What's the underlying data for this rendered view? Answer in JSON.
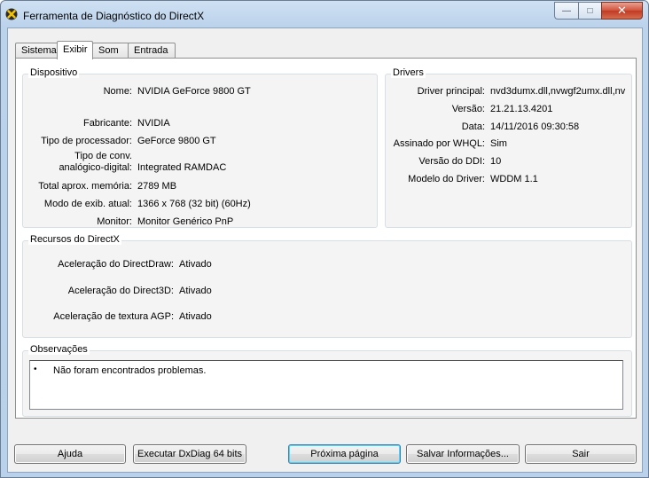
{
  "window": {
    "title": "Ferramenta de Diagnóstico do DirectX"
  },
  "caption": {
    "minimize": "—",
    "maximize": "□",
    "close": "✕"
  },
  "tabs": [
    "Sistema",
    "Exibir",
    "Som",
    "Entrada"
  ],
  "device": {
    "title": "Dispositivo",
    "rows": [
      {
        "label": "Nome:",
        "value": "NVIDIA GeForce 9800 GT"
      },
      {
        "label": "Fabricante:",
        "value": "NVIDIA"
      },
      {
        "label": "Tipo de processador:",
        "value": "GeForce 9800 GT"
      },
      {
        "label": "Tipo de conv.",
        "label2": "analógico-digital:",
        "value": "Integrated RAMDAC"
      },
      {
        "label": "Total aprox. memória:",
        "value": "2789 MB"
      },
      {
        "label": "Modo de exib. atual:",
        "value": "1366 x 768 (32 bit) (60Hz)"
      },
      {
        "label": "Monitor:",
        "value": "Monitor Genérico PnP"
      }
    ]
  },
  "drivers": {
    "title": "Drivers",
    "rows": [
      {
        "label": "Driver principal:",
        "value": "nvd3dumx.dll,nvwgf2umx.dll,nv"
      },
      {
        "label": "Versão:",
        "value": "21.21.13.4201"
      },
      {
        "label": "Data:",
        "value": "14/11/2016 09:30:58"
      },
      {
        "label": "Assinado por WHQL:",
        "value": "Sim"
      },
      {
        "label": "Versão do DDI:",
        "value": "10"
      },
      {
        "label": "Modelo do Driver:",
        "value": "WDDM 1.1"
      }
    ]
  },
  "directx": {
    "title": "Recursos do DirectX",
    "rows": [
      {
        "label": "Aceleração do DirectDraw:",
        "value": "Ativado"
      },
      {
        "label": "Aceleração do Direct3D:",
        "value": "Ativado"
      },
      {
        "label": "Aceleração de textura AGP:",
        "value": "Ativado"
      }
    ]
  },
  "notes": {
    "title": "Observações",
    "bullet": "•",
    "items": [
      "Não foram encontrados problemas."
    ]
  },
  "buttons": {
    "help": "Ajuda",
    "run64": "Executar DxDiag 64 bits",
    "next": "Próxima página",
    "save": "Salvar Informações...",
    "exit": "Sair"
  }
}
